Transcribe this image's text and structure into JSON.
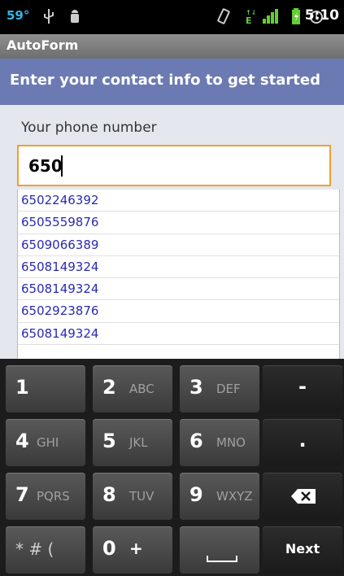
{
  "status_bar": {
    "temperature": "59°",
    "time": "5:10"
  },
  "app": {
    "title": "AutoForm"
  },
  "header": {
    "text": "Enter your contact info to get started"
  },
  "form": {
    "phone_label": "Your phone number",
    "phone_value": "650",
    "suggestions": [
      "6502246392",
      "6505559876",
      "6509066389",
      "6508149324",
      "6508149324",
      "6502923876",
      "6508149324"
    ]
  },
  "keypad": {
    "keys": [
      {
        "num": "1",
        "letters": ""
      },
      {
        "num": "2",
        "letters": "ABC"
      },
      {
        "num": "3",
        "letters": "DEF"
      },
      {
        "num": "4",
        "letters": "GHI"
      },
      {
        "num": "5",
        "letters": "JKL"
      },
      {
        "num": "6",
        "letters": "MNO"
      },
      {
        "num": "7",
        "letters": "PQRS"
      },
      {
        "num": "8",
        "letters": "TUV"
      },
      {
        "num": "9",
        "letters": "WXYZ"
      }
    ],
    "dash": "-",
    "period": ".",
    "symbols": "* # (",
    "zero": "0",
    "zero_plus": "+",
    "next": "Next"
  },
  "colors": {
    "accent_border": "#f0a030",
    "header_bg": "#6b7ab3",
    "suggestion_text": "#2a2ab0",
    "status_blue": "#33b5e5"
  }
}
